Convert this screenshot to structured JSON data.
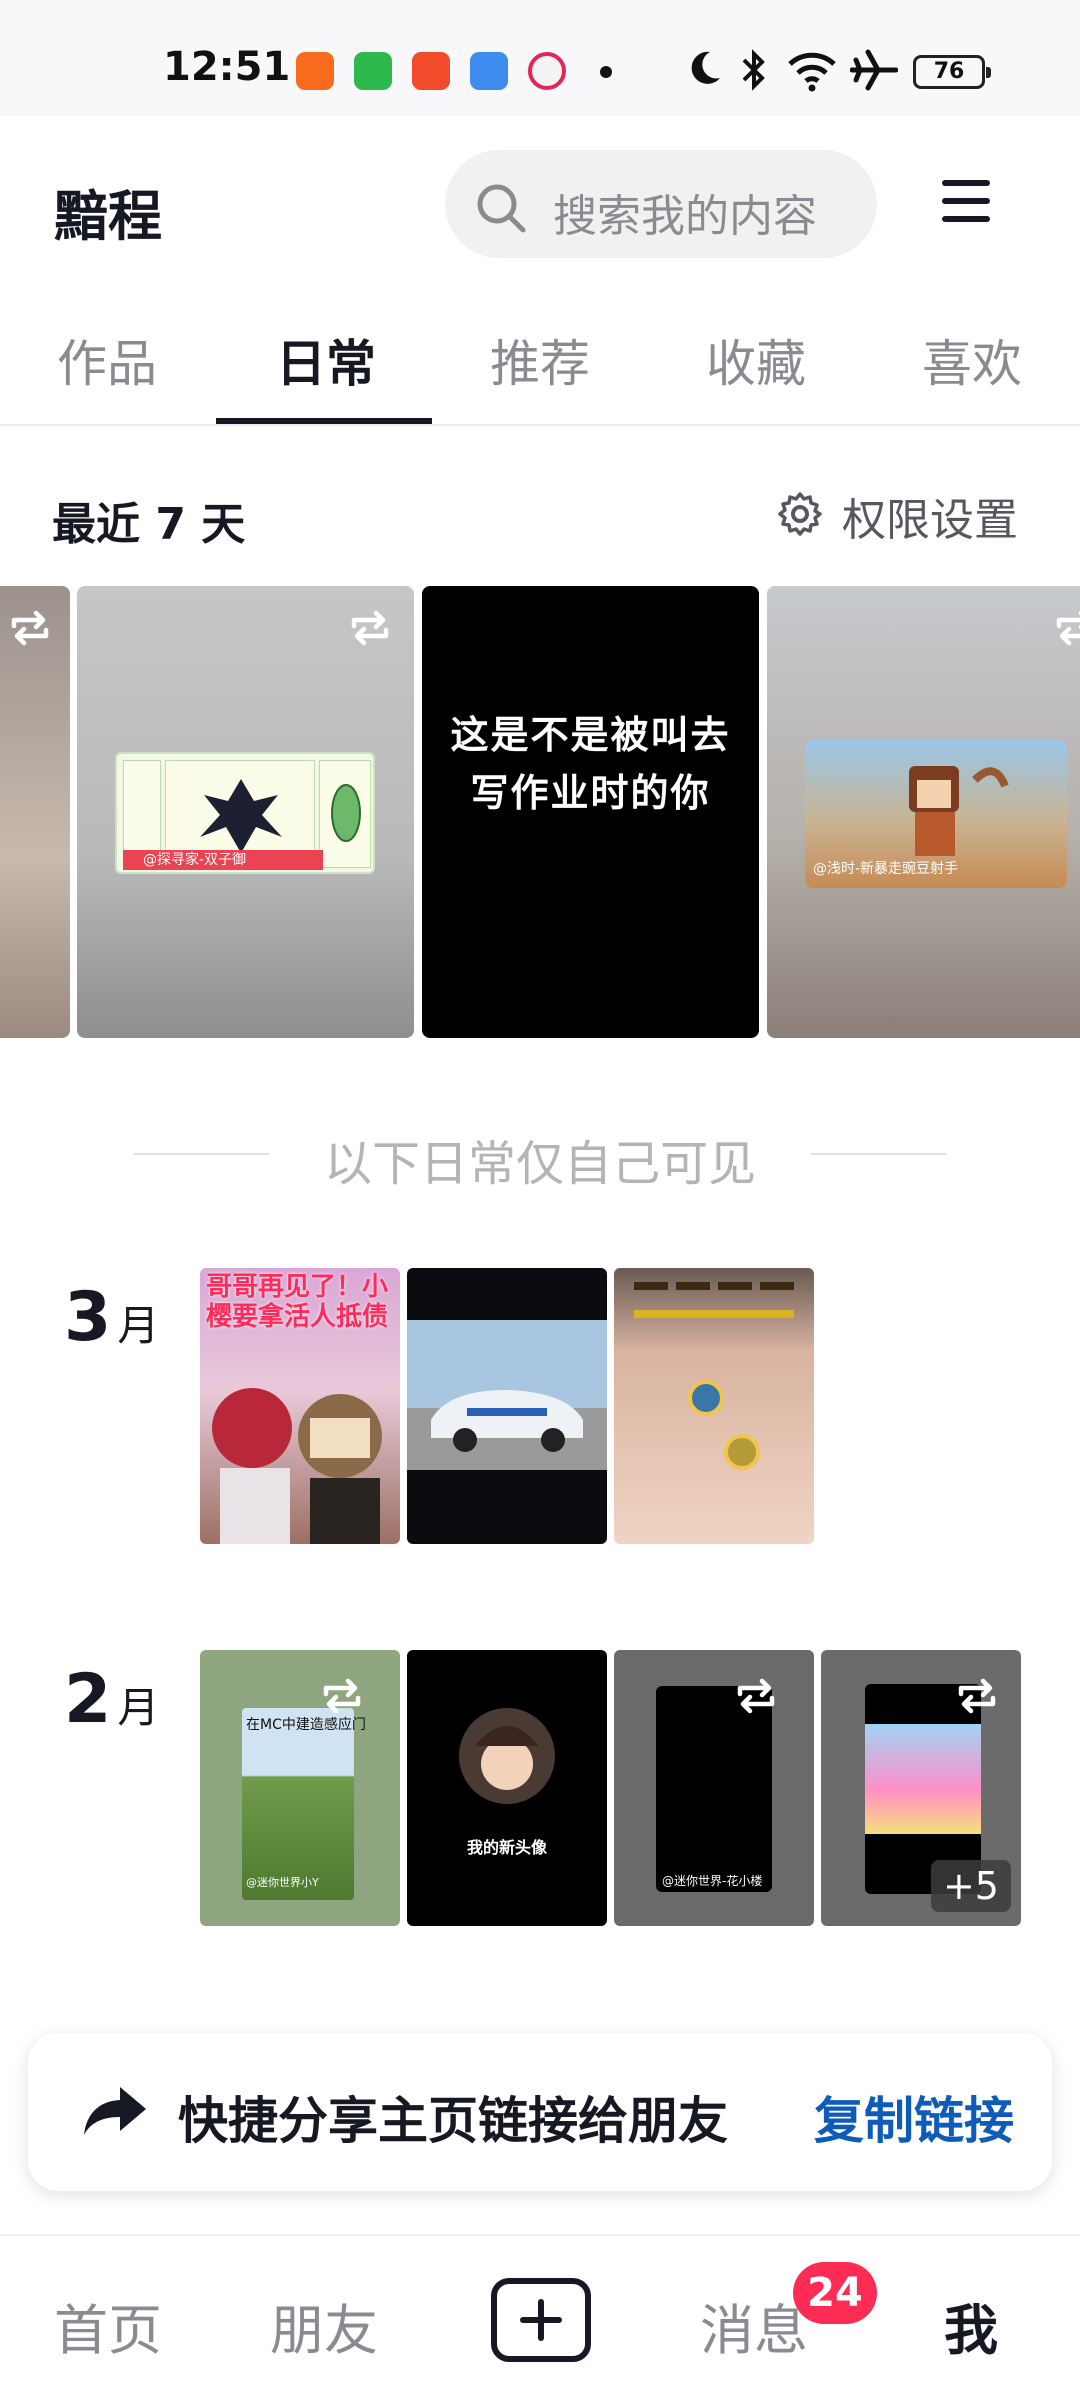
{
  "status_bar": {
    "time": "12:51",
    "battery": "76"
  },
  "header": {
    "username": "黯程",
    "search_placeholder": "搜索我的内容",
    "menu_icon": "hamburger-menu-icon"
  },
  "tabs": [
    {
      "label": "作品",
      "active": false
    },
    {
      "label": "日常",
      "active": true
    },
    {
      "label": "推荐",
      "active": false
    },
    {
      "label": "收藏",
      "active": false
    },
    {
      "label": "喜欢",
      "active": false
    }
  ],
  "recent": {
    "title": "最近 7 天",
    "permission_label": "权限设置",
    "items": [
      {
        "caption": ""
      },
      {
        "caption": "@探寻家-双子御"
      },
      {
        "caption": "这是不是被叫去写作业时的你"
      },
      {
        "caption": "@浅时-新暴走豌豆射手"
      }
    ]
  },
  "only_self_notice": "以下日常仅自己可见",
  "months": [
    {
      "number": "3",
      "unit": "月"
    },
    {
      "number": "2",
      "unit": "月"
    }
  ],
  "month_captions": {
    "march_1": "哥哥再见了！小樱要拿活人抵债",
    "feb_1_title": "在MC中建造感应门",
    "feb_1_user": "@迷你世界小Y",
    "feb_2_title": "我的新头像",
    "feb_3_user": "@迷你世界-花小楼",
    "feb_4_more": "+5"
  },
  "share": {
    "text": "快捷分享主页链接给朋友",
    "action": "复制链接"
  },
  "bottom_nav": {
    "home": "首页",
    "friends": "朋友",
    "messages": "消息",
    "messages_badge": "24",
    "me": "我"
  },
  "colors": {
    "accent_red": "#fe2c55",
    "link_blue": "#0f5bba",
    "text_primary": "#161823",
    "text_secondary": "#8a8b91"
  }
}
